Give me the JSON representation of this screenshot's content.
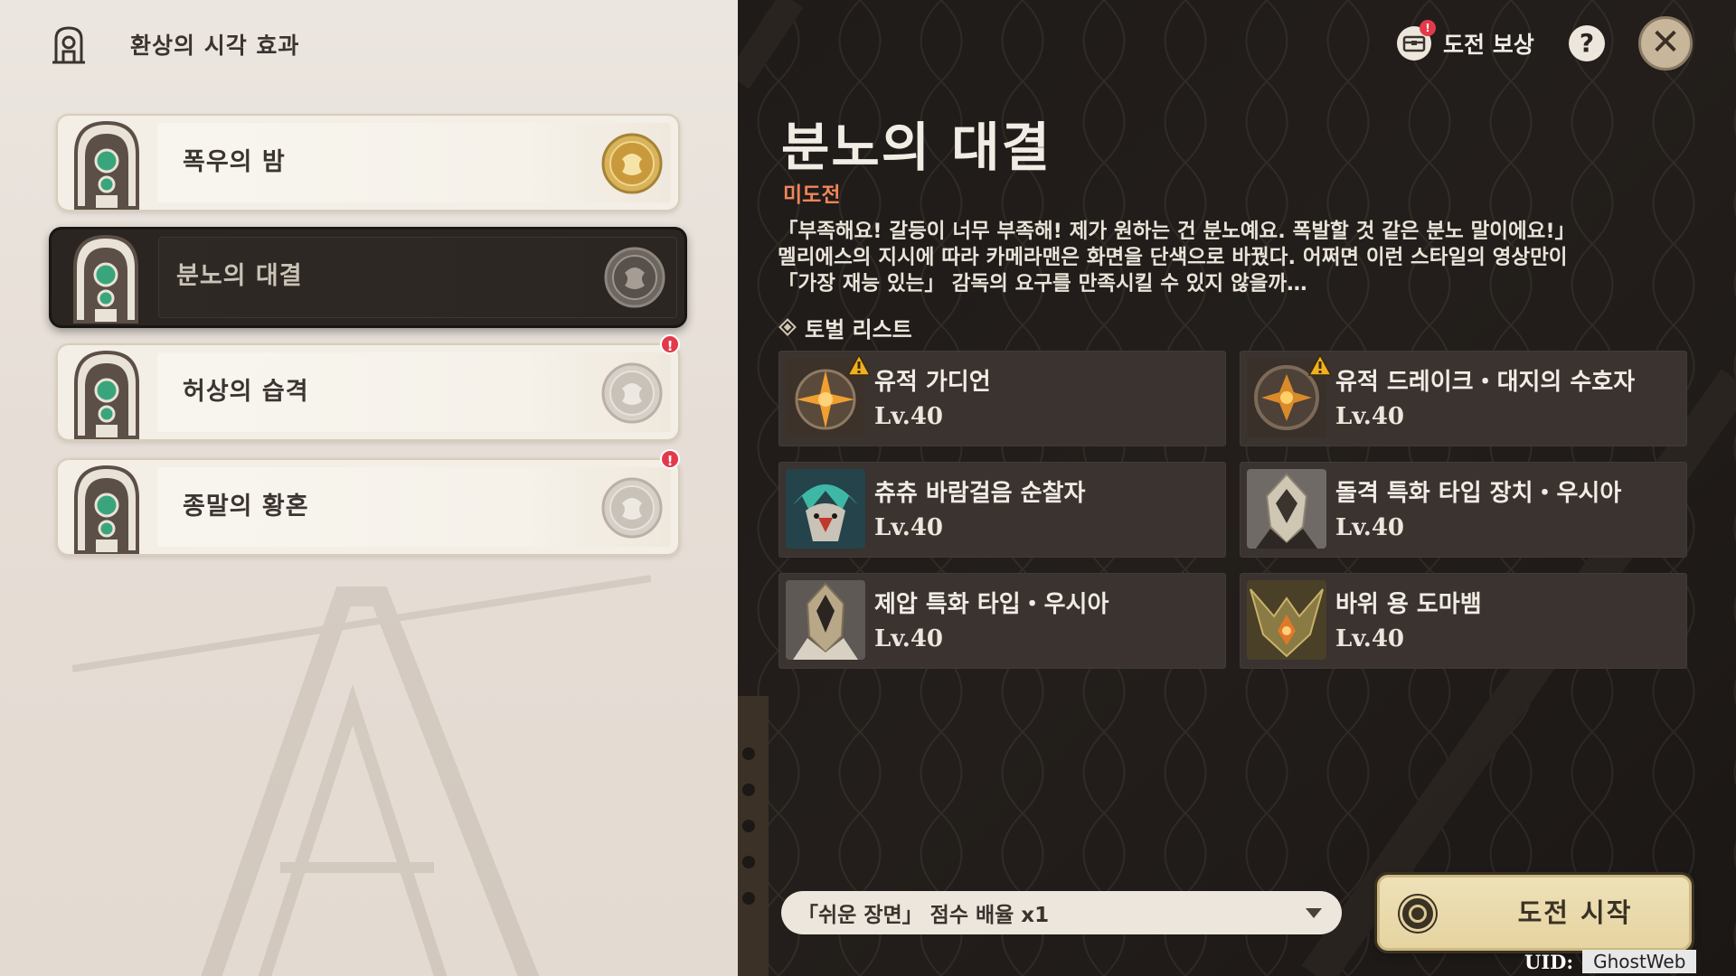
{
  "header": {
    "title": "환상의 시각 효과",
    "icon": "shrine-icon"
  },
  "stages": [
    {
      "label": "폭우의 밤",
      "medal": "gold-medal-icon",
      "selected": false,
      "alert": false
    },
    {
      "label": "분노의 대결",
      "medal": "grey-medal-icon",
      "selected": true,
      "alert": false
    },
    {
      "label": "허상의 습격",
      "medal": "grey-medal-icon",
      "selected": false,
      "alert": true
    },
    {
      "label": "종말의 황혼",
      "medal": "grey-medal-icon",
      "selected": false,
      "alert": true
    }
  ],
  "alert_glyph": "!",
  "topbar": {
    "reward_label": "도전 보상",
    "reward_alert": "!",
    "help_glyph": "?",
    "close_glyph": "✕"
  },
  "domain": {
    "title": "분노의 대결",
    "status": "미도전",
    "description": [
      "「부족해요! 갈등이 너무 부족해! 제가 원하는 건 분노예요. 폭발할 것 같은 분노 말이에요!」",
      "멜리에스의 지시에 따라 카메라맨은 화면을 단색으로 바꿨다. 어쩌면 이런 스타일의 영상만이",
      "「가장 재능 있는」 감독의 요구를 만족시킬 수 있지 않을까…"
    ],
    "enemy_heading": "토벌 리스트"
  },
  "enemies": [
    {
      "name": "유적 가디언",
      "level": "Lv.40",
      "warning": true,
      "portrait": "ruin-guard"
    },
    {
      "name": "유적 드레이크・대지의 수호자",
      "level": "Lv.40",
      "warning": true,
      "portrait": "ruin-drake"
    },
    {
      "name": "츄츄 바람걸음 순찰자",
      "level": "Lv.40",
      "warning": false,
      "portrait": "hilichurl"
    },
    {
      "name": "돌격 특화 타입 장치・우시아",
      "level": "Lv.40",
      "warning": false,
      "portrait": "assault-ousia"
    },
    {
      "name": "제압 특화 타입・우시아",
      "level": "Lv.40",
      "warning": false,
      "portrait": "suppression-ousia"
    },
    {
      "name": "바위 용 도마뱀",
      "level": "Lv.40",
      "warning": false,
      "portrait": "geovishap"
    }
  ],
  "footer": {
    "difficulty_value": "「쉬운 장면」 점수 배율 x1",
    "start_label": "도전 시작",
    "uid_key": "UID:",
    "uid_value": "GhostWeb"
  },
  "colors": {
    "left_bg": "#e8e1da",
    "right_bg": "#1f1b19",
    "status": "#f0855a",
    "card": "#3a3330",
    "start_button": "#e6d4a1",
    "alert": "#e33a4a"
  }
}
